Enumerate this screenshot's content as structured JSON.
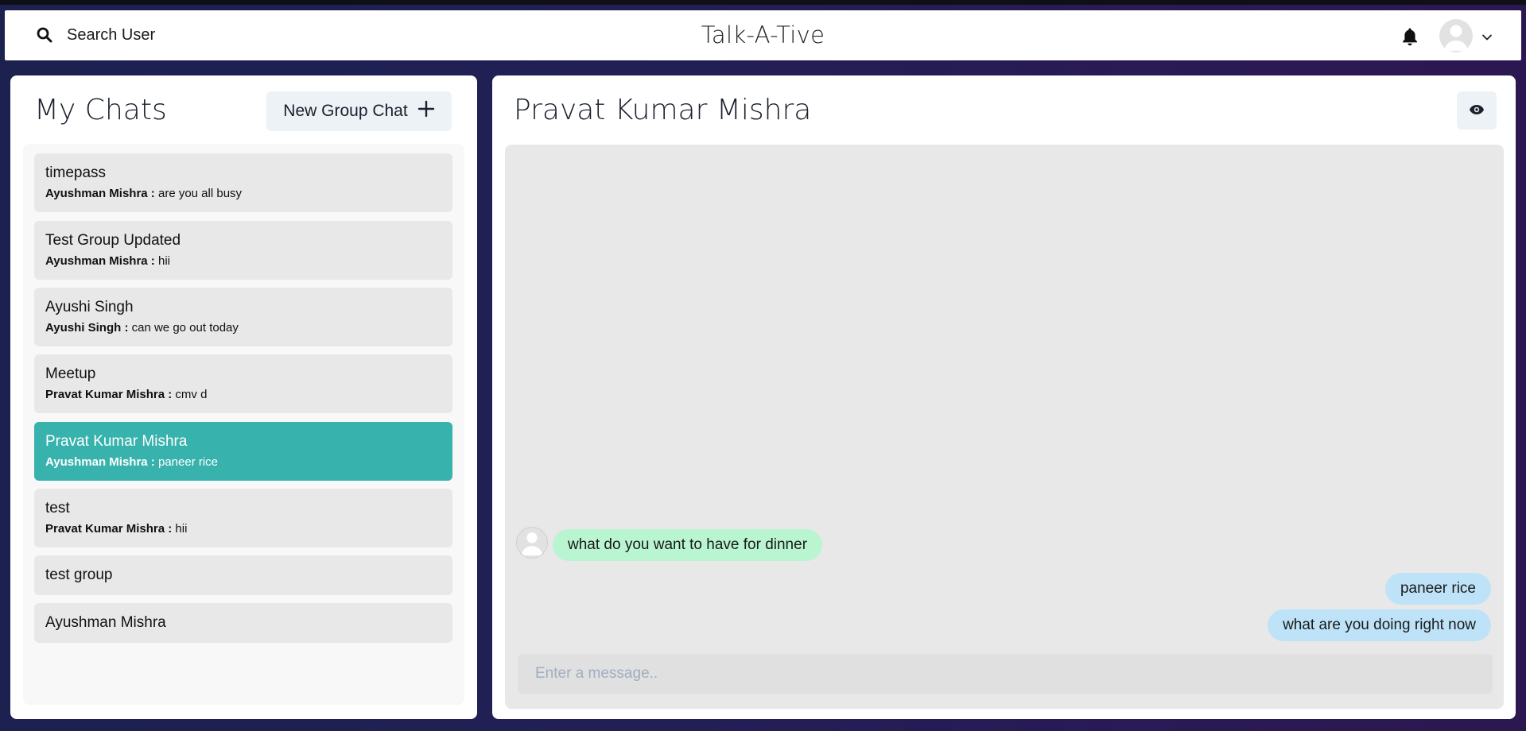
{
  "header": {
    "search_label": "Search User",
    "app_title": "Talk-A-Tive"
  },
  "sidebar": {
    "title": "My Chats",
    "new_group_label": "New Group Chat",
    "chats": [
      {
        "name": "timepass",
        "sender": "Ayushman Mishra :",
        "message": "are you all busy",
        "active": false
      },
      {
        "name": "Test Group Updated",
        "sender": "Ayushman Mishra :",
        "message": "hii",
        "active": false
      },
      {
        "name": "Ayushi Singh",
        "sender": "Ayushi Singh :",
        "message": "can we go out today",
        "active": false
      },
      {
        "name": "Meetup",
        "sender": "Pravat Kumar Mishra :",
        "message": "cmv d",
        "active": false
      },
      {
        "name": "Pravat Kumar Mishra",
        "sender": "Ayushman Mishra :",
        "message": "paneer rice",
        "active": true
      },
      {
        "name": "test",
        "sender": "Pravat Kumar Mishra :",
        "message": "hii",
        "active": false
      },
      {
        "name": "test group",
        "active": false
      },
      {
        "name": "Ayushman Mishra",
        "active": false
      }
    ]
  },
  "chat": {
    "title": "Pravat Kumar Mishra",
    "messages": [
      {
        "text": "what do you want to have for dinner",
        "direction": "incoming"
      },
      {
        "text": "paneer rice",
        "direction": "outgoing"
      },
      {
        "text": "what are you doing right now",
        "direction": "outgoing"
      }
    ],
    "input_placeholder": "Enter a message.."
  },
  "icons": {
    "search": "search-icon",
    "bell": "bell-icon",
    "avatar": "avatar-icon",
    "chevron": "chevron-down-icon",
    "plus": "plus-icon",
    "eye": "eye-icon"
  },
  "colors": {
    "active_chat": "#38b2ac",
    "incoming_bubble": "#b9f5d0",
    "outgoing_bubble": "#bee3f8"
  }
}
